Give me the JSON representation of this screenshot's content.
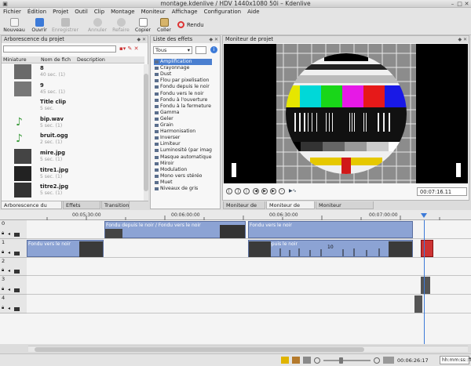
{
  "window": {
    "title": "montage.kdenlive / HDV 1440x1080 50i – Kdenlive"
  },
  "menu": [
    "Fichier",
    "Édition",
    "Projet",
    "Outil",
    "Clip",
    "Montage",
    "Moniteur",
    "Affichage",
    "Configuration",
    "Aide"
  ],
  "toolbar": {
    "new": "Nouveau",
    "open": "Ouvrir",
    "save": "Enregistrer",
    "undo": "Annuler",
    "redo": "Refaire",
    "copy": "Copier",
    "paste": "Coller",
    "render": "Rendu"
  },
  "project_tree": {
    "title": "Arborescence du projet",
    "search_placeholder": "",
    "columns": [
      "Miniature",
      "Nom de fich",
      "Description"
    ],
    "items": [
      {
        "name": "8",
        "duration": "40 sec. (1)"
      },
      {
        "name": "9",
        "duration": "45 sec. (1)"
      },
      {
        "name": "Title clip",
        "duration": "5 sec."
      },
      {
        "name": "bip.wav",
        "duration": "5 sec. (1)"
      },
      {
        "name": "bruit.ogg",
        "duration": "2 sec. (1)"
      },
      {
        "name": "mire.jpg",
        "duration": "5 sec. (1)"
      },
      {
        "name": "titre1.jpg",
        "duration": "5 sec. (1)"
      },
      {
        "name": "titre2.jpg",
        "duration": "5 sec. (1)"
      }
    ],
    "tabs": [
      "Arborescence du projet",
      "Effets utilisés",
      "Transition"
    ]
  },
  "effects": {
    "title": "Liste des effets",
    "filter": "Tous",
    "items": [
      "Amplification",
      "Crayonnage",
      "Dust",
      "Flou par pixelisation",
      "Fondu depuis le noir",
      "Fondu vers le noir",
      "Fondu à l'ouverture",
      "Fondu à la fermeture",
      "Gamma",
      "Geler",
      "Grain",
      "Harmonisation",
      "Inverser",
      "Limiteur",
      "Luminosité (par images)",
      "Masque automatique",
      "Miroir",
      "Modulation",
      "Mono vers stéréo",
      "Muet",
      "Niveaux de gris"
    ]
  },
  "monitor": {
    "title": "Moniteur de projet",
    "timecode": "00:07:16.11",
    "tabs": [
      "Moniteur de clip",
      "Moniteur de projet",
      "Moniteur d'acquisition"
    ]
  },
  "timeline": {
    "ruler": [
      "00:05:30:00",
      "00:06:00:00",
      "00:06:30:00",
      "00:07:00:00"
    ],
    "tracks": [
      "0",
      "1",
      "2",
      "3",
      "4"
    ],
    "clips": {
      "t0_a": "Fondu depuis le noir / Fondu vers le noir",
      "t0_b": "Fondu vers le noir",
      "t1_a": "Fondu vers le noir",
      "t1_b": "Fondu depuis le noir",
      "t1_kf": "10"
    }
  },
  "status": {
    "timecode": "00:06:26:17",
    "format": "hh:mm:ss::ff"
  },
  "colors": {
    "accent": "#4a7fd0",
    "clip": "#8ca3d4",
    "clipDark": "#6d86bf"
  }
}
